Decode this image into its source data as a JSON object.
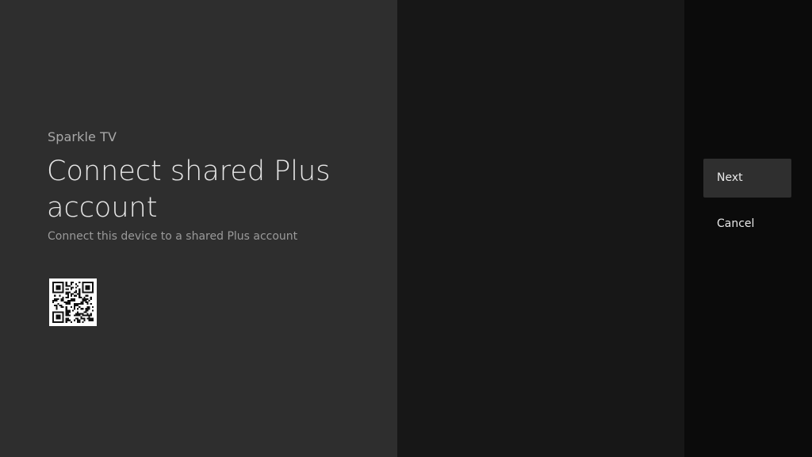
{
  "guidance": {
    "breadcrumb": "Sparkle TV",
    "title": "Connect shared Plus account",
    "description": "Connect this device to a shared Plus account",
    "qr_icon": "qr-code-icon"
  },
  "actions": [
    {
      "label": "Next",
      "focused": true
    },
    {
      "label": "Cancel",
      "focused": false
    }
  ],
  "colors": {
    "guidance_bg": "#2e2e2e",
    "middle_bg": "#171717",
    "actions_bg": "#0b0b0b",
    "focused_action_bg": "#2f2f2f"
  }
}
